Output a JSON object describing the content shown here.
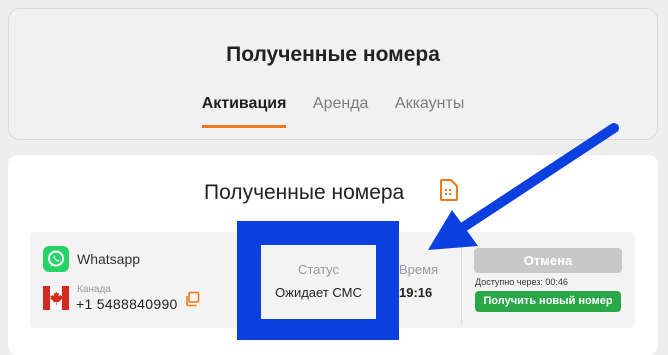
{
  "header": {
    "title": "Полученные номера",
    "tabs": [
      {
        "label": "Активация",
        "active": true
      },
      {
        "label": "Аренда",
        "active": false
      },
      {
        "label": "Аккаунты",
        "active": false
      }
    ]
  },
  "section": {
    "title": "Полученные номера",
    "icon": "sim-card-icon"
  },
  "order": {
    "service": "Whatsapp",
    "service_icon": "whatsapp-icon",
    "country": "Канада",
    "country_icon": "canada-flag-icon",
    "phone": "+1 5488840990",
    "status_label": "Статус",
    "status_value": "Ожидает СМС",
    "time_label": "Время",
    "time_value": "19:16",
    "cancel_label": "Отмена",
    "available_text": "Доступно через: 00:46",
    "new_number_label": "Получить новый номер"
  },
  "colors": {
    "accent": "#ee7a1d",
    "success": "#2aa847",
    "annotation": "#0c3fe0"
  }
}
